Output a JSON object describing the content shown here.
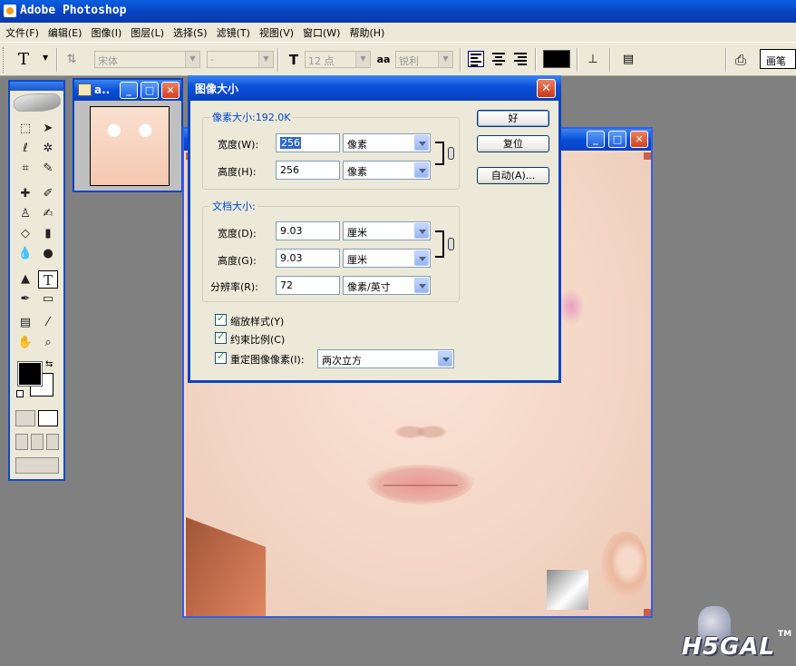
{
  "app": {
    "title": "Adobe Photoshop"
  },
  "menu": [
    "文件(F)",
    "编辑(E)",
    "图像(I)",
    "图层(L)",
    "选择(S)",
    "滤镜(T)",
    "视图(V)",
    "窗口(W)",
    "帮助(H)"
  ],
  "options": {
    "tool_glyph": "T",
    "font_family": "宋体",
    "font_style": "-",
    "font_size": "12 点",
    "aa_label": "aa",
    "antialias": "锐利",
    "text_color": "#000000",
    "palette_tab": "画笔"
  },
  "thumb_window": {
    "title": "a.."
  },
  "dialog": {
    "title": "图像大小",
    "pixel_dims_legend": "像素大小:192.0K",
    "px_width_label": "宽度(W):",
    "px_width_value": "256",
    "px_width_unit": "像素",
    "px_height_label": "高度(H):",
    "px_height_value": "256",
    "px_height_unit": "像素",
    "doc_size_legend": "文档大小:",
    "doc_width_label": "宽度(D):",
    "doc_width_value": "9.03",
    "doc_width_unit": "厘米",
    "doc_height_label": "高度(G):",
    "doc_height_value": "9.03",
    "doc_height_unit": "厘米",
    "resolution_label": "分辨率(R):",
    "resolution_value": "72",
    "resolution_unit": "像素/英寸",
    "scale_styles": "缩放样式(Y)",
    "constrain": "约束比例(C)",
    "resample": "重定图像像素(I):",
    "resample_method": "两次立方",
    "ok": "好",
    "reset": "复位",
    "auto": "自动(A)..."
  },
  "watermark": {
    "text": "H5GAL",
    "tm": "TM"
  }
}
